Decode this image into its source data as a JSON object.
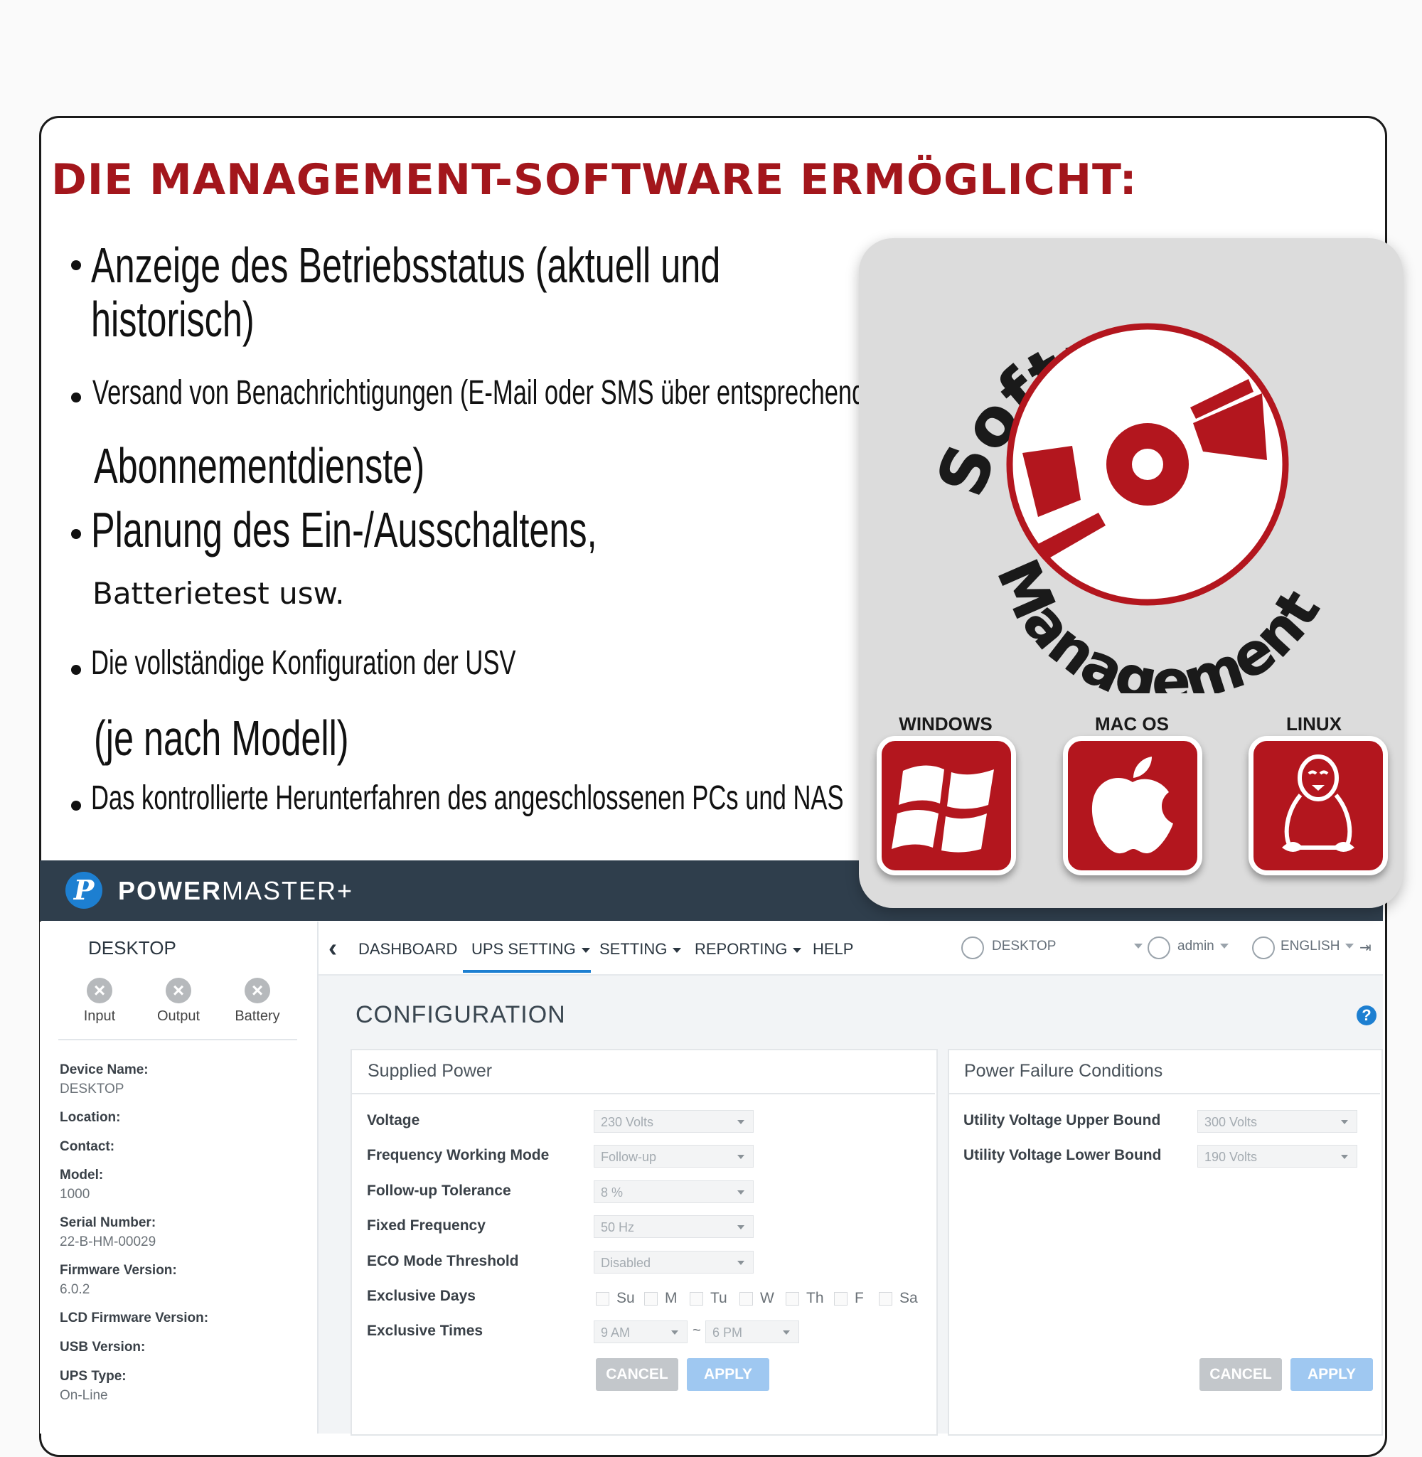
{
  "headline": "DIE MANAGEMENT-SOFTWARE ERMÖGLICHT:",
  "bullets": {
    "b1_line1": "Anzeige des Betriebsstatus (aktuell und",
    "b1_line2": "historisch)",
    "b2_line1": "Versand von Benachrichtigungen (E-Mail oder SMS über entsprechende",
    "b2_line2": "Abonnementdienste)",
    "b3_line1": "Planung des Ein-/Ausschaltens,",
    "b3_line2": "Batterietest usw.",
    "b4_line1": "Die vollständige Konfiguration der USV",
    "b4_line2": "(je nach Modell)",
    "b5_line1": "Das kontrollierte Herunterfahren des angeschlossenen PCs und NAS"
  },
  "badge": {
    "arc_top": "Software",
    "arc_bottom": "Management",
    "os": [
      "WINDOWS",
      "MAC OS",
      "LINUX"
    ],
    "colors": {
      "brand_red": "#b3161e",
      "badge_bg": "#dcdcdc"
    }
  },
  "app": {
    "logo_letter": "P",
    "brand_bold": "POWER",
    "brand_rest": "MASTER+",
    "sidebar": {
      "title": "DESKTOP",
      "status": [
        "Input",
        "Output",
        "Battery"
      ],
      "info": [
        {
          "label": "Device Name:",
          "value": "DESKTOP"
        },
        {
          "label": "Location:",
          "value": ""
        },
        {
          "label": "Contact:",
          "value": ""
        },
        {
          "label": "Model:",
          "value": "1000"
        },
        {
          "label": "Serial Number:",
          "value": "22-B-HM-00029"
        },
        {
          "label": "Firmware Version:",
          "value": "6.0.2"
        },
        {
          "label": "LCD Firmware Version:",
          "value": ""
        },
        {
          "label": "USB Version:",
          "value": ""
        },
        {
          "label": "UPS Type:",
          "value": "On-Line"
        }
      ]
    },
    "nav": {
      "back": "‹",
      "items": [
        "DASHBOARD",
        "UPS SETTING",
        "SETTING",
        "REPORTING",
        "HELP"
      ],
      "active": "UPS SETTING",
      "device": "DESKTOP",
      "user": "admin",
      "language": "ENGLISH"
    },
    "config_title": "CONFIGURATION",
    "help": "?",
    "supplied_power": {
      "title": "Supplied Power",
      "rows": [
        {
          "label": "Voltage",
          "value": "230 Volts"
        },
        {
          "label": "Frequency Working Mode",
          "value": "Follow-up"
        },
        {
          "label": "Follow-up Tolerance",
          "value": "8 %"
        },
        {
          "label": "Fixed Frequency",
          "value": "50 Hz"
        },
        {
          "label": "ECO Mode Threshold",
          "value": "Disabled"
        }
      ],
      "exclusive_days_label": "Exclusive Days",
      "days": [
        "Su",
        "M",
        "Tu",
        "W",
        "Th",
        "F",
        "Sa"
      ],
      "exclusive_times_label": "Exclusive Times",
      "time_from": "9 AM",
      "time_sep": "~",
      "time_to": "6 PM",
      "cancel": "CANCEL",
      "apply": "APPLY"
    },
    "power_failure": {
      "title": "Power Failure Conditions",
      "rows": [
        {
          "label": "Utility Voltage Upper Bound",
          "value": "300 Volts"
        },
        {
          "label": "Utility Voltage Lower Bound",
          "value": "190 Volts"
        }
      ],
      "cancel": "CANCEL",
      "apply": "APPLY"
    }
  }
}
